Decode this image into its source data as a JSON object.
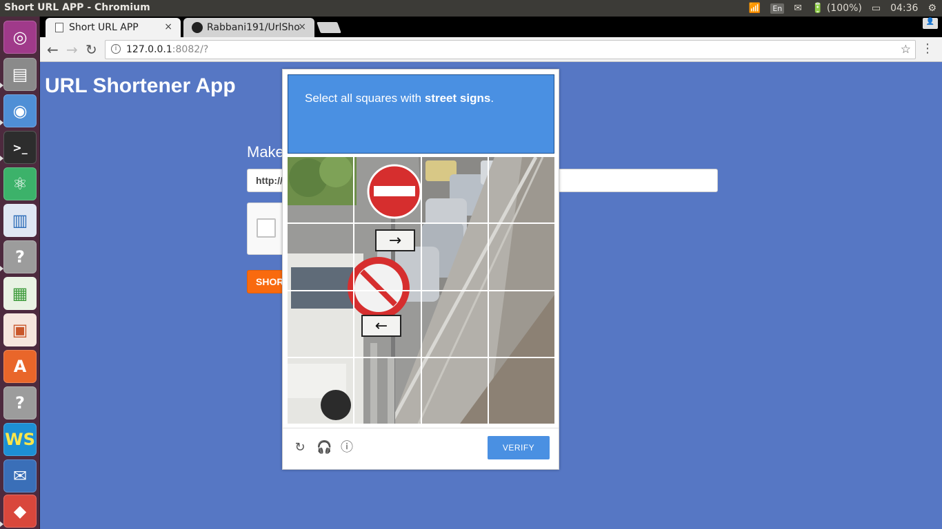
{
  "os": {
    "window_title": "Short URL APP - Chromium",
    "tray": {
      "keyboard": "En",
      "battery": "(100%)",
      "clock": "04:36"
    }
  },
  "browser": {
    "tabs": [
      {
        "label": "Short URL APP",
        "close": "×"
      },
      {
        "label": "Rabbani191/UrlSho",
        "close": "×"
      }
    ],
    "address": {
      "host": "127.0.0.1",
      "rest": ":8082/?"
    }
  },
  "page": {
    "title": "URL Shortener App",
    "make_label": "Make",
    "input_value": "http://",
    "shorten_label": "SHOR"
  },
  "captcha": {
    "instruction_prefix": "Select all squares with ",
    "instruction_target": "street signs",
    "instruction_suffix": ".",
    "verify_label": "VERIFY"
  },
  "colors": {
    "page_bg": "#5677c4",
    "captcha_blue": "#4a90e2",
    "shorten_orange": "#f96a0e"
  }
}
